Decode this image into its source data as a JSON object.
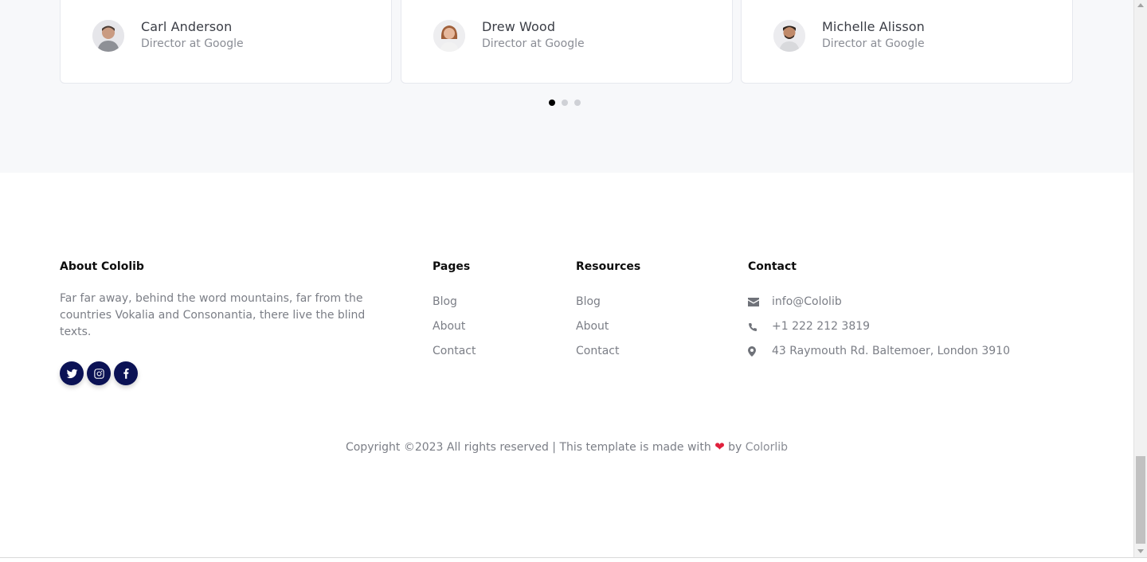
{
  "testimonials": {
    "cards": [
      {
        "name": "Carl Anderson",
        "role": "Director at Google",
        "avatar_icon": "person-avatar-icon"
      },
      {
        "name": "Drew Wood",
        "role": "Director at Google",
        "avatar_icon": "person-avatar-icon"
      },
      {
        "name": "Michelle Alisson",
        "role": "Director at Google",
        "avatar_icon": "person-avatar-icon"
      }
    ],
    "carousel_active_index": 0,
    "carousel_count": 3
  },
  "footer": {
    "about": {
      "heading": "About Cololib",
      "text": "Far far away, behind the word mountains, far from the countries Vokalia and Consonantia, there live the blind texts.",
      "social": [
        "twitter-icon",
        "instagram-icon",
        "facebook-icon"
      ]
    },
    "pages": {
      "heading": "Pages",
      "links": [
        "Blog",
        "About",
        "Contact"
      ]
    },
    "resources": {
      "heading": "Resources",
      "links": [
        "Blog",
        "About",
        "Contact"
      ]
    },
    "contact": {
      "heading": "Contact",
      "email": "info@Cololib",
      "phone": "+1 222 212 3819",
      "address": "43 Raymouth Rd. Baltemoer, London 3910"
    }
  },
  "copyright": {
    "prefix": "Copyright ©2023 All rights reserved | This template is made with",
    "by": "by",
    "brand": "Colorlib"
  },
  "colors": {
    "social_bg": "#0b1255",
    "heart": "#e0203c",
    "section_bg": "#f7f8fa"
  }
}
